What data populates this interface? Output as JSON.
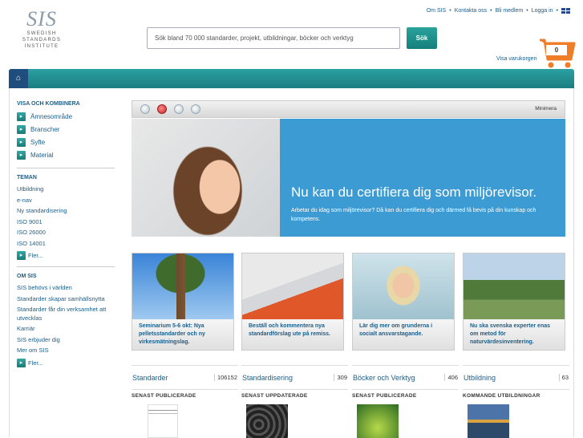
{
  "logo": {
    "mark": "SIS",
    "line1": "SWEDISH",
    "line2": "STANDARDS",
    "line3": "INSTITUTE"
  },
  "topnav": {
    "items": [
      "Om SIS",
      "Kontakta oss",
      "Bli medlem",
      "Logga in"
    ],
    "separator": "•"
  },
  "search": {
    "placeholder": "Sök bland 70 000 standarder, projekt, utbildningar, böcker och verktyg",
    "button": "Sök"
  },
  "cart": {
    "count": "0",
    "label": "Visa varukorgen"
  },
  "sidebar": {
    "visa_title": "VISA OCH KOMBINERA",
    "filters": [
      "Ämnesområde",
      "Branscher",
      "Syfte",
      "Material"
    ],
    "teman_title": "TEMAN",
    "teman": [
      "Utbildning",
      "e-nav",
      "Ny standardisering",
      "ISO 9001",
      "ISO 26000",
      "ISO 14001"
    ],
    "teman_more": "Fler...",
    "om_title": "OM SIS",
    "om": [
      "SIS behövs i världen",
      "Standarder skapar samhällsnytta",
      "Standarder får din verksamhet att utvecklas",
      "Karriär",
      "SIS erbjuder dig",
      "Mer om SIS"
    ],
    "om_more": "Fler..."
  },
  "carousel": {
    "minimize": "Minimera",
    "active_index": 1
  },
  "hero": {
    "title": "Nu kan du certifiera dig som miljörevisor.",
    "text": "Arbetar du idag som miljörevisor? Då kan du certifiera dig och därmed få bevis på din kunskap och kompetens."
  },
  "cards": [
    {
      "caption": "Seminarium 5-6 okt: Nya pelletsstandarder och ny virkesmätningslag."
    },
    {
      "caption": "Beställ och kommentera nya standardförslag ute på remiss."
    },
    {
      "caption": "Lär dig mer om grunderna i socialt ansvarstagande."
    },
    {
      "caption": "Nu ska svenska experter enas om metod för naturvärdesinventering."
    }
  ],
  "columns": [
    {
      "title": "Standarder",
      "count": "106152",
      "subtitle": "SENAST PUBLICERADE"
    },
    {
      "title": "Standardisering",
      "count": "309",
      "subtitle": "SENAST UPPDATERADE"
    },
    {
      "title": "Böcker och Verktyg",
      "count": "406",
      "subtitle": "SENAST PUBLICERADE"
    },
    {
      "title": "Utbildning",
      "count": "63",
      "subtitle": "KOMMANDE UTBILDNINGAR"
    }
  ],
  "colors": {
    "teal": "#1b7d80",
    "hero_blue": "#3d9bd3",
    "link": "#1b5e8a",
    "cart_orange": "#f07d28"
  }
}
